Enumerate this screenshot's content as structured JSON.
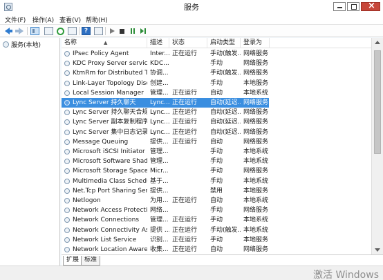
{
  "window": {
    "title": "服务",
    "accent_color": "#3a8ee0"
  },
  "menu": [
    {
      "label": "文件(F)"
    },
    {
      "label": "操作(A)"
    },
    {
      "label": "查看(V)"
    },
    {
      "label": "帮助(H)"
    }
  ],
  "toolbar_icons": [
    "back-arrow-icon",
    "forward-arrow-icon",
    "show-tree-icon",
    "properties-icon",
    "refresh-icon",
    "export-icon",
    "help-icon",
    "console-icon",
    "start-service-icon",
    "stop-service-icon",
    "pause-service-icon",
    "restart-service-icon"
  ],
  "tree": {
    "root_label": "服务(本地)"
  },
  "columns": {
    "name": "名称",
    "desc": "描述",
    "status": "状态",
    "startup": "启动类型",
    "logon": "登录为"
  },
  "rows": [
    {
      "name": "IPsec Policy Agent",
      "desc": "Inter...",
      "status": "正在运行",
      "startup": "手动(触发...",
      "logon": "网络服务"
    },
    {
      "name": "KDC Proxy Server service...",
      "desc": "KDC...",
      "status": "",
      "startup": "手动",
      "logon": "网络服务"
    },
    {
      "name": "KtmRm for Distributed Tr...",
      "desc": "协调...",
      "status": "",
      "startup": "手动(触发...",
      "logon": "网络服务"
    },
    {
      "name": "Link-Layer Topology Disc...",
      "desc": "创建...",
      "status": "",
      "startup": "手动",
      "logon": "本地服务"
    },
    {
      "name": "Local Session Manager",
      "desc": "管理...",
      "status": "正在运行",
      "startup": "自动",
      "logon": "本地系统"
    },
    {
      "name": "Lync Server 持久聊天",
      "desc": "Lync...",
      "status": "正在运行",
      "startup": "自动(延迟...",
      "logon": "网络服务",
      "selected": true
    },
    {
      "name": "Lync Server 持久聊天合规性",
      "desc": "Lync...",
      "status": "正在运行",
      "startup": "自动(延迟...",
      "logon": "网络服务"
    },
    {
      "name": "Lync Server 副本复制程序...",
      "desc": "Lync...",
      "status": "正在运行",
      "startup": "自动(延迟...",
      "logon": "网络服务"
    },
    {
      "name": "Lync Server 集中日志记录...",
      "desc": "Lync...",
      "status": "正在运行",
      "startup": "自动(延迟...",
      "logon": "网络服务"
    },
    {
      "name": "Message Queuing",
      "desc": "提供...",
      "status": "正在运行",
      "startup": "自动",
      "logon": "网络服务"
    },
    {
      "name": "Microsoft iSCSI Initiator ...",
      "desc": "管理...",
      "status": "",
      "startup": "手动",
      "logon": "本地系统"
    },
    {
      "name": "Microsoft Software Shad...",
      "desc": "管理...",
      "status": "",
      "startup": "手动",
      "logon": "本地系统"
    },
    {
      "name": "Microsoft Storage Space...",
      "desc": "Micr...",
      "status": "",
      "startup": "手动",
      "logon": "网络服务"
    },
    {
      "name": "Multimedia Class Schedu...",
      "desc": "基于...",
      "status": "",
      "startup": "手动",
      "logon": "本地系统"
    },
    {
      "name": "Net.Tcp Port Sharing Ser...",
      "desc": "提供...",
      "status": "",
      "startup": "禁用",
      "logon": "本地服务"
    },
    {
      "name": "Netlogon",
      "desc": "为用...",
      "status": "正在运行",
      "startup": "自动",
      "logon": "本地系统"
    },
    {
      "name": "Network Access Protecti...",
      "desc": "网络...",
      "status": "",
      "startup": "手动",
      "logon": "网络服务"
    },
    {
      "name": "Network Connections",
      "desc": "管理...",
      "status": "正在运行",
      "startup": "手动",
      "logon": "本地系统"
    },
    {
      "name": "Network Connectivity Ass...",
      "desc": "提供 ...",
      "status": "正在运行",
      "startup": "手动(触发...",
      "logon": "本地系统"
    },
    {
      "name": "Network List Service",
      "desc": "识别...",
      "status": "正在运行",
      "startup": "手动",
      "logon": "本地服务"
    },
    {
      "name": "Network Location Aware...",
      "desc": "收集...",
      "status": "正在运行",
      "startup": "自动",
      "logon": "网络服务"
    }
  ],
  "tabs": [
    {
      "label": "扩展"
    },
    {
      "label": "标准"
    }
  ],
  "watermark": "激活 Windows"
}
